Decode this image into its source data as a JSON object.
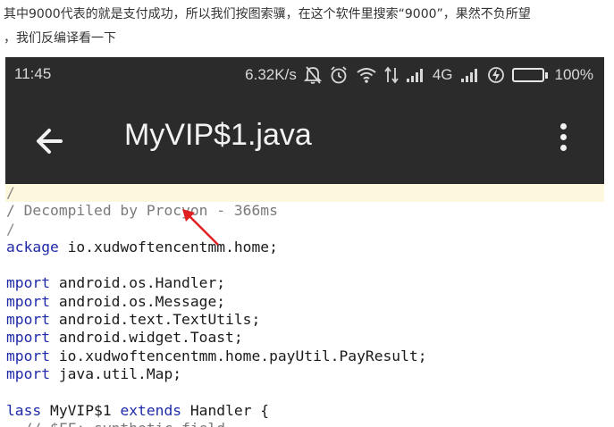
{
  "article": {
    "intro_line1": "其中9000代表的就是支付成功，所以我们按图索骥，在这个软件里搜索“9000”，果然不负所望",
    "intro_line2": "，我们反编译看一下"
  },
  "status_bar": {
    "time": "11:45",
    "speed": "6.32K/s",
    "network": "4G",
    "battery": "100%",
    "battery_level": 1.0,
    "battery_color": "#36d63a"
  },
  "toolbar": {
    "title": "MyVIP$1.java",
    "back_icon": "arrow-back-icon",
    "menu_icon": "more-vertical-icon"
  },
  "code": {
    "comment_open": "/",
    "decompiled_note": "/ Decompiled by Procyon - 366ms",
    "comment_close": "/",
    "package_kw": "ackage",
    "package_name": " io.xudwoftencentmm.home;",
    "import_kw": "mport",
    "imports": [
      " android.os.Handler;",
      " android.os.Message;",
      " android.text.TextUtils;",
      " android.widget.Toast;",
      " io.xudwoftencentmm.home.payUtil.PayResult;",
      " java.util.Map;"
    ],
    "class_kw": "lass",
    "class_name": " MyVIP$1 ",
    "extends_kw": "extends",
    "class_rest": " Handler {",
    "field_comment": "  // $FF: synthetic field"
  },
  "colors": {
    "appbar": "#2b2b2b",
    "keyword": "#1f2aa8",
    "comment": "#7a7a7a",
    "highlight": "#fdf7dd",
    "annotation_arrow": "#e02020"
  }
}
